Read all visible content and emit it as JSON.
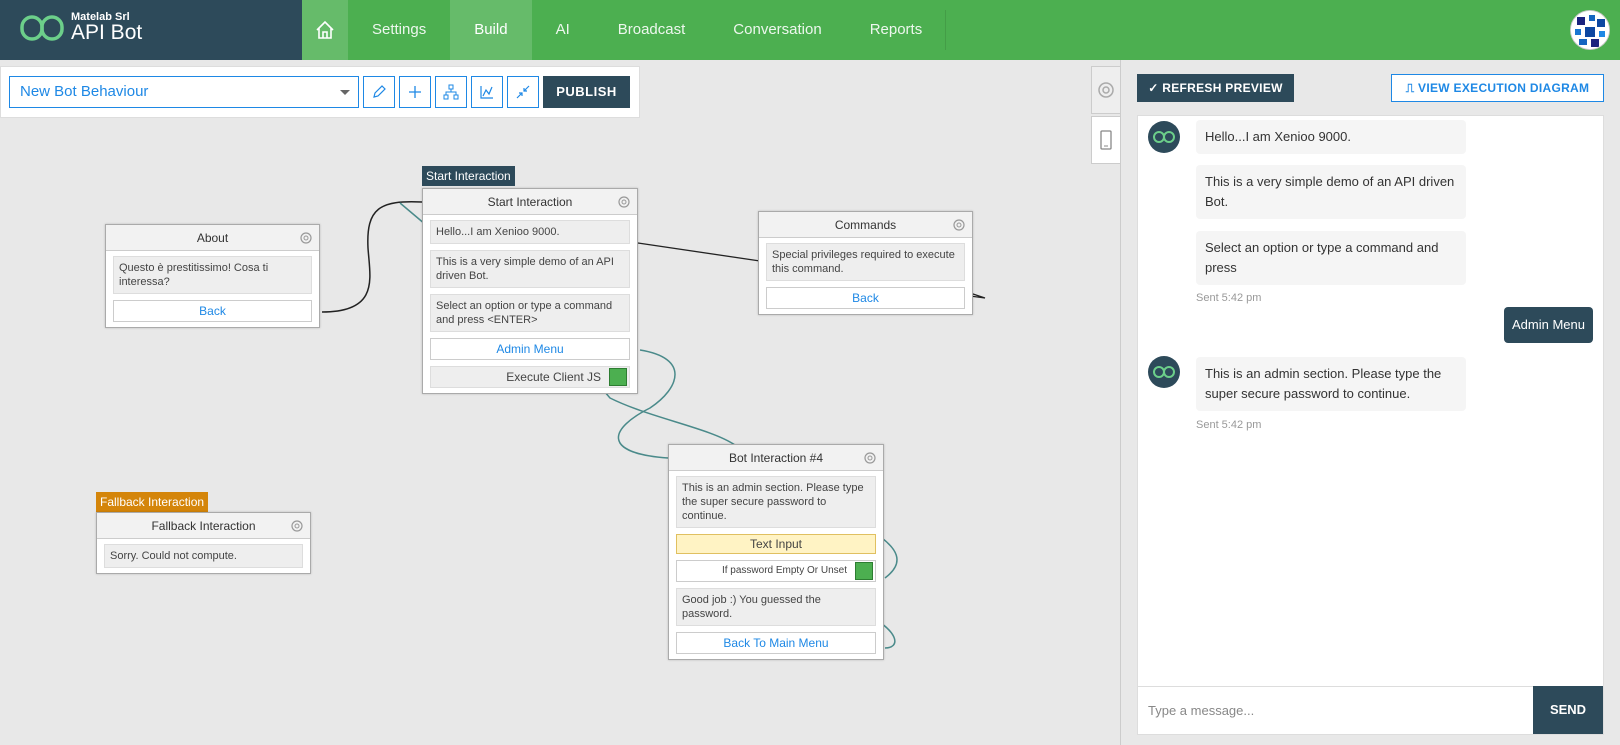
{
  "brand": {
    "company": "Matelab Srl",
    "app_name": "API Bot"
  },
  "nav": {
    "home_icon": "home-icon",
    "items": [
      "Settings",
      "Build",
      "AI",
      "Broadcast",
      "Conversation",
      "Reports"
    ],
    "active": "Build"
  },
  "toolbar": {
    "behaviour_value": "New Bot Behaviour",
    "publish_label": "PUBLISH",
    "tools": [
      "pencil-icon",
      "plus-icon",
      "hierarchy-icon",
      "chart-icon",
      "collapse-icon"
    ]
  },
  "canvas": {
    "about": {
      "title": "About",
      "message": "Questo è prestitissimo! Cosa ti interessa?",
      "button": "Back"
    },
    "start": {
      "tag": "Start Interaction",
      "title": "Start Interaction",
      "messages": [
        "Hello...I am Xenioo 9000.",
        "This is a very simple demo of an API driven Bot.",
        "Select an option or type a command and press <ENTER>"
      ],
      "button": "Admin Menu",
      "action": "Execute Client JS"
    },
    "commands": {
      "title": "Commands",
      "message": "Special privileges required to execute this command.",
      "button": "Back"
    },
    "bot4": {
      "title": "Bot Interaction #4",
      "message": "This is an admin section. Please type the super secure password to continue.",
      "text_input": "Text Input",
      "condition": "If password Empty Or Unset",
      "message2": "Good job :) You guessed the password.",
      "button": "Back To Main Menu"
    },
    "fallback": {
      "tag": "Fallback Interaction",
      "title": "Fallback Interaction",
      "message": "Sorry. Could not compute."
    }
  },
  "preview": {
    "refresh_label": "REFRESH PREVIEW",
    "exec_label": "VIEW EXECUTION DIAGRAM",
    "chat": {
      "bot1": "Hello...I am Xenioo 9000.",
      "bot2": "This is a very simple demo of an API driven Bot.",
      "bot3": "Select an option or type a command and press",
      "sent1": "Sent 5:42 pm",
      "user1": "Admin Menu",
      "bot4": "This is an admin section. Please type the super secure password to continue.",
      "sent2": "Sent 5:42 pm"
    },
    "input_placeholder": "Type a message...",
    "send_label": "SEND"
  },
  "colors": {
    "topbar": "#4caf50",
    "brand_bg": "#2d4a5a",
    "accent": "#1e88e5",
    "start_tag": "#2d4a5a",
    "fallback_tag": "#d4850a"
  }
}
